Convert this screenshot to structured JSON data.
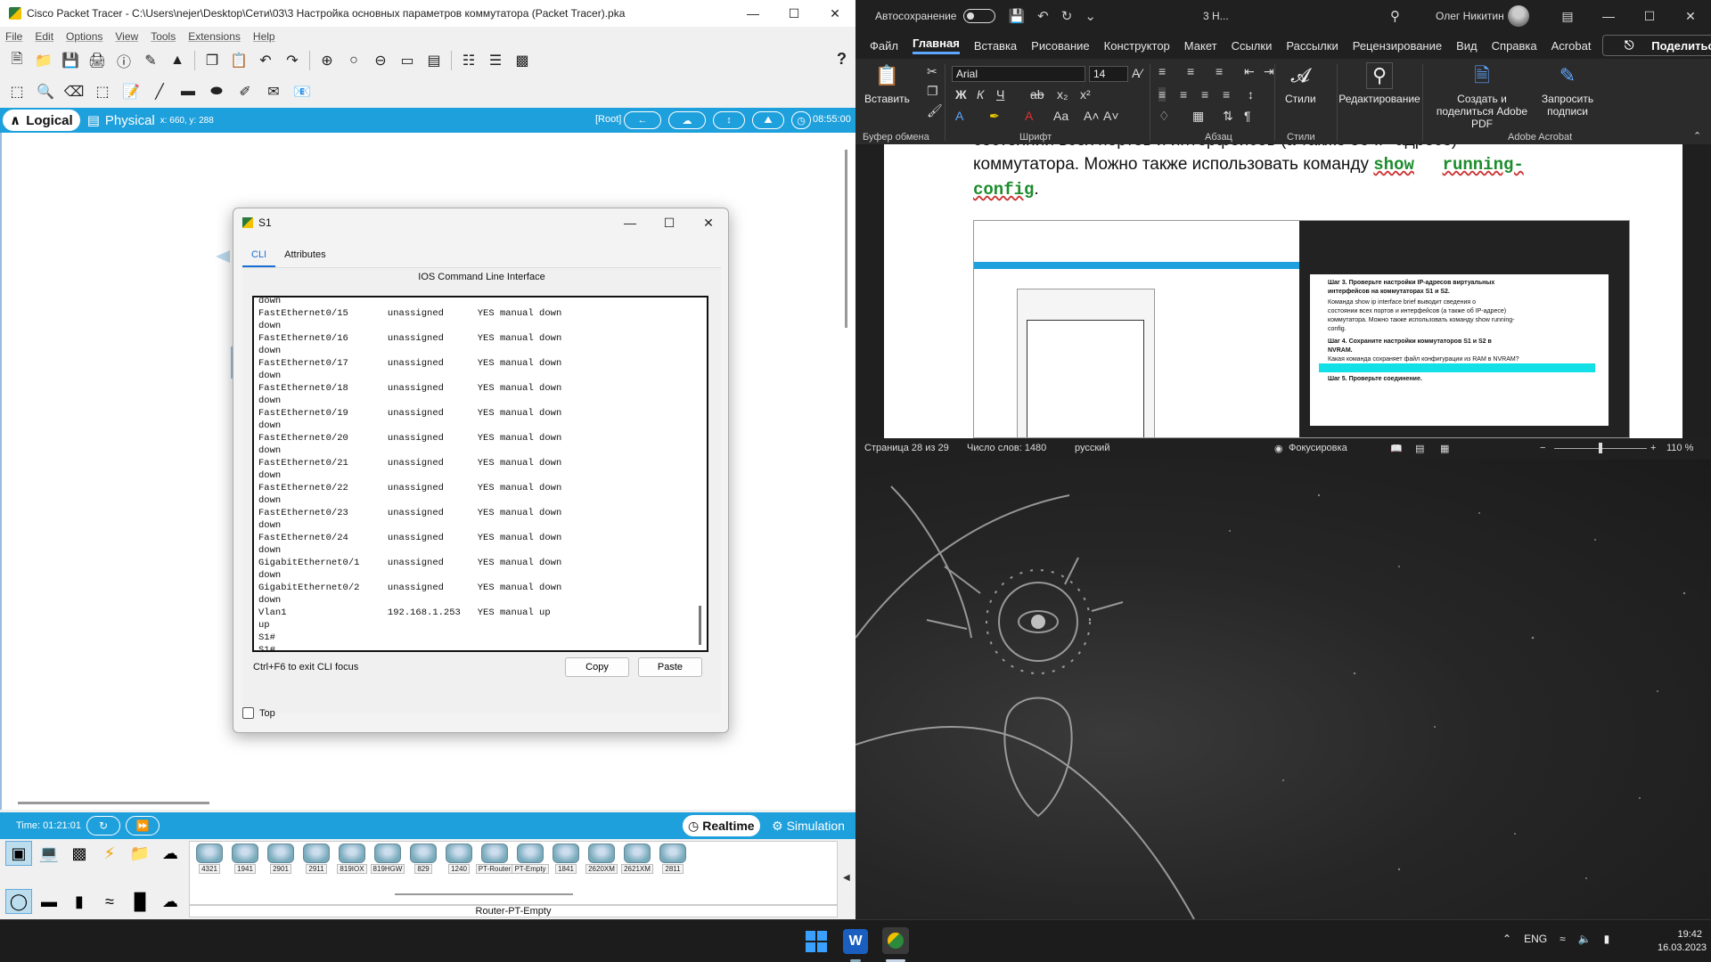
{
  "pt": {
    "title": "Cisco Packet Tracer - C:\\Users\\nejer\\Desktop\\Сети\\03\\3 Настройка основных параметров коммутатора (Packet Tracer).pka",
    "menu": [
      "File",
      "Edit",
      "Options",
      "View",
      "Tools",
      "Extensions",
      "Help"
    ],
    "help_glyph": "?",
    "mode_logical": "Logical",
    "mode_physical": "Physical",
    "coords": "x: 660, y: 288",
    "root": "[Root]",
    "clock": "08:55:00",
    "time": "Time: 01:21:01",
    "realtime": "Realtime",
    "simulation": "Simulation",
    "devices": [
      "4321",
      "1941",
      "2901",
      "2911",
      "819IOX",
      "819HGW",
      "829",
      "1240",
      "PT-Router",
      "PT-Empty",
      "1841",
      "2620XM",
      "2621XM",
      "2811"
    ],
    "device_caption": "Router-PT-Empty"
  },
  "s1": {
    "title": "S1",
    "tab_cli": "CLI",
    "tab_attributes": "Attributes",
    "heading": "IOS Command Line Interface",
    "cli_lines": [
      "down",
      "FastEthernet0/15       unassigned      YES manual down",
      "down",
      "FastEthernet0/16       unassigned      YES manual down",
      "down",
      "FastEthernet0/17       unassigned      YES manual down",
      "down",
      "FastEthernet0/18       unassigned      YES manual down",
      "down",
      "FastEthernet0/19       unassigned      YES manual down",
      "down",
      "FastEthernet0/20       unassigned      YES manual down",
      "down",
      "FastEthernet0/21       unassigned      YES manual down",
      "down",
      "FastEthernet0/22       unassigned      YES manual down",
      "down",
      "FastEthernet0/23       unassigned      YES manual down",
      "down",
      "FastEthernet0/24       unassigned      YES manual down",
      "down",
      "GigabitEthernet0/1     unassigned      YES manual down",
      "down",
      "GigabitEthernet0/2     unassigned      YES manual down",
      "down",
      "Vlan1                  192.168.1.253   YES manual up",
      "up",
      "S1#",
      "S1#"
    ],
    "hint": "Ctrl+F6 to exit CLI focus",
    "copy": "Copy",
    "paste": "Paste",
    "top": "Top"
  },
  "word": {
    "autosave": "Автосохранение",
    "doc_short": "3 Н...",
    "user": "Олег Никитин",
    "tabs": [
      "Файл",
      "Главная",
      "Вставка",
      "Рисование",
      "Конструктор",
      "Макет",
      "Ссылки",
      "Рассылки",
      "Рецензирование",
      "Вид",
      "Справка",
      "Acrobat"
    ],
    "share": "Поделиться",
    "paste_label": "Вставить",
    "font": "Arial",
    "size": "14",
    "styles": "Стили",
    "editing": "Редактирование",
    "create_pdf": "Создать и поделиться Adobe PDF",
    "request_sign": "Запросить подписи",
    "groups": [
      "Буфер обмена",
      "Шрифт",
      "Абзац",
      "Стили",
      "Adobe Acrobat"
    ],
    "doc_partial": "состоянии всех портов и интерфейсов (а также об IP-адресе)",
    "doc_line1_a": "коммутатора. Можно также использовать команду ",
    "doc_cmd1": "show",
    "doc_cmd2": "running-",
    "doc_cmd3": "config",
    "doc_end": ".",
    "shot_lines": [
      "Шаг 3. Проверьте настройки IP-адресов виртуальных",
      "интерфейсов на коммутаторах S1 и S2.",
      "Команда show ip interface brief выводит сведения о",
      "состоянии всех портов и интерфейсов (а также об IP-адресе)",
      "коммутатора. Можно также использовать команду show running-",
      "config.",
      "Шаг 4. Сохраните настройки коммутаторов S1 и S2 в",
      "NVRAM.",
      "Какая команда сохраняет файл конфигурации из RAM в NVRAM?",
      "Шаг 5. Проверьте соединение."
    ],
    "status_page": "Страница 28 из 29",
    "status_words": "Число слов: 1480",
    "status_lang": "русский",
    "status_focus": "Фокусировка",
    "zoom": "110 %"
  },
  "taskbar": {
    "lang": "ENG",
    "time": "19:42",
    "date": "16.03.2023"
  }
}
